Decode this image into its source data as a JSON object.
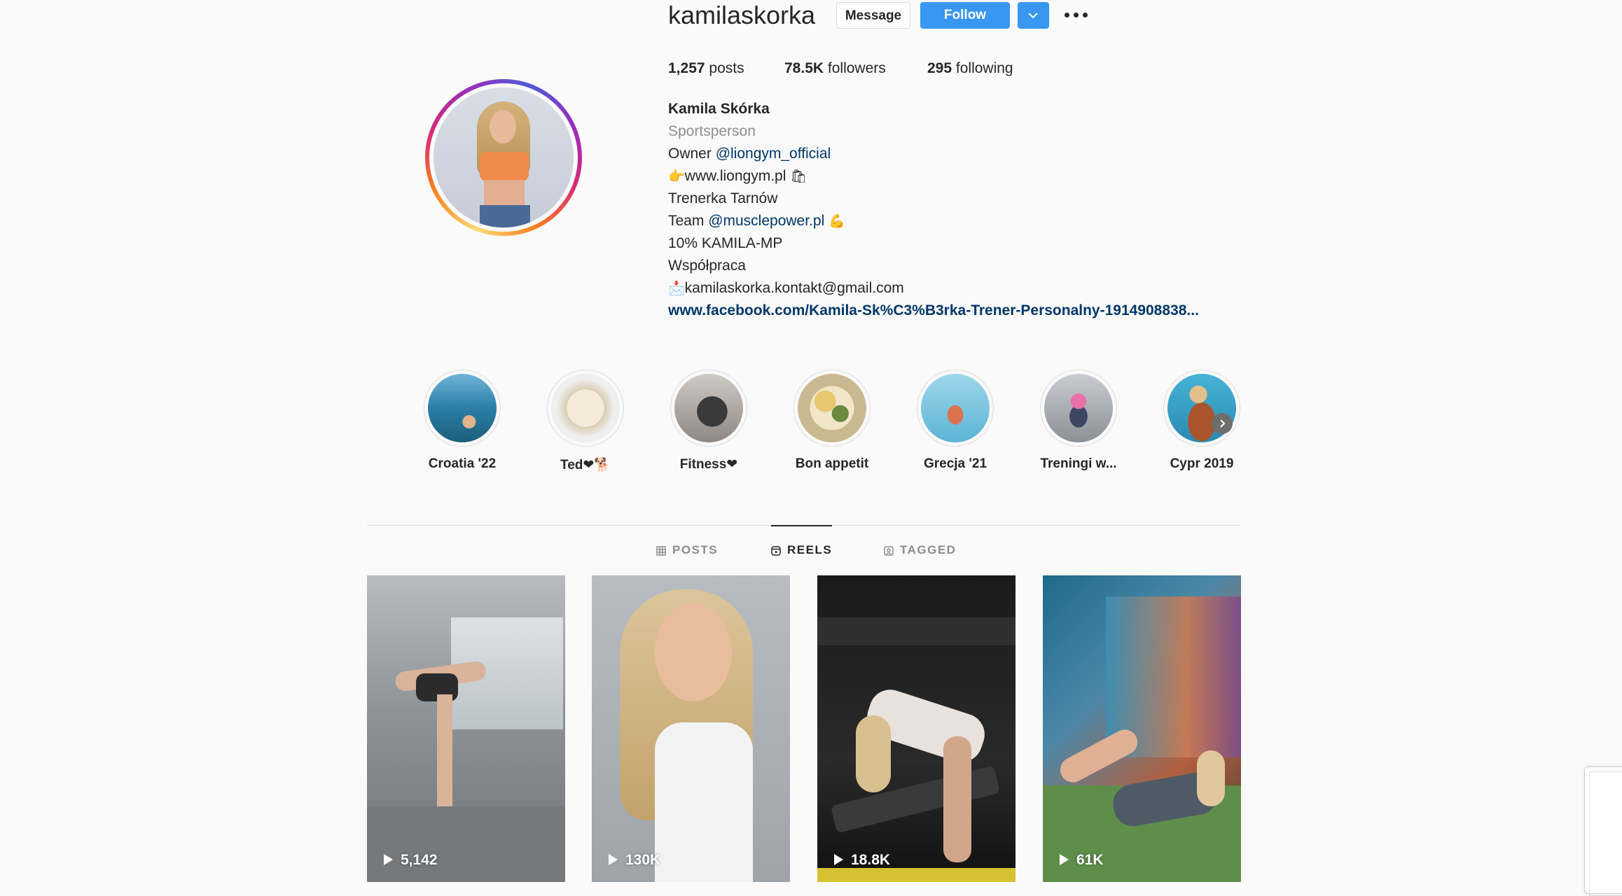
{
  "profile": {
    "username": "kamilaskorka",
    "buttons": {
      "message": "Message",
      "follow": "Follow"
    },
    "stats": {
      "posts_count": "1,257",
      "posts_label": "posts",
      "followers_count": "78.5K",
      "followers_label": "followers",
      "following_count": "295",
      "following_label": "following"
    },
    "bio": {
      "full_name": "Kamila Skórka",
      "category": "Sportsperson",
      "line_owner_prefix": "Owner ",
      "line_owner_mention": "@liongym_official",
      "line_site_emoji_left": "👉",
      "line_site": "www.liongym.pl ",
      "line_site_emoji_right": "🛍",
      "line_trainer": "Trenerka Tarnów",
      "line_team_prefix": "Team ",
      "line_team_mention": "@musclepower.pl",
      "line_team_emoji": "💪",
      "line_code": "10% KAMILA-MP",
      "line_collab": "Współpraca",
      "line_email_emoji": "📩",
      "line_email": "kamilaskorka.kontakt@gmail.com",
      "link": "www.facebook.com/Kamila-Sk%C3%B3rka-Trener-Personalny-1914908838..."
    }
  },
  "highlights": [
    {
      "label": "Croatia '22",
      "icon": "beach-photo"
    },
    {
      "label": "Ted❤🐕",
      "icon": "dog-photo"
    },
    {
      "label": "Fitness❤",
      "icon": "gym-photo"
    },
    {
      "label": "Bon appetit",
      "icon": "food-photo"
    },
    {
      "label": "Grecja '21",
      "icon": "pool-photo"
    },
    {
      "label": "Treningi w...",
      "icon": "workout-photo"
    },
    {
      "label": "Cypr 2019",
      "icon": "poolside-photo"
    }
  ],
  "tabs": {
    "posts": "POSTS",
    "reels": "REELS",
    "tagged": "TAGGED",
    "active": "reels"
  },
  "reels": [
    {
      "views": "5,142"
    },
    {
      "views": "130K"
    },
    {
      "views": "18.8K"
    },
    {
      "views": "61K"
    }
  ],
  "colors": {
    "follow_button": "#3897f0",
    "link_blue": "#00376b",
    "muted_text": "#8e8e8e"
  }
}
